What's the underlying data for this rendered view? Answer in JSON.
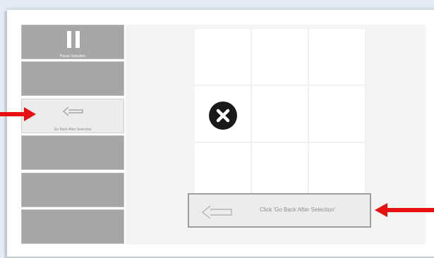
{
  "sidebar": {
    "pause_label": "Pause Selection",
    "back_label": "Go Back After Selection"
  },
  "main": {
    "hint_label": "Click 'Go Back After Selection'"
  },
  "icons": {
    "pause": "pause-icon",
    "back": "arrow-left-icon",
    "close": "x-circle-icon",
    "pointer": "red-arrow-icon"
  },
  "colors": {
    "sidebar_button": "#a6a6a6",
    "active_button": "#ececec",
    "pointer_arrow": "#e81010",
    "badge": "#1a1a1a"
  }
}
